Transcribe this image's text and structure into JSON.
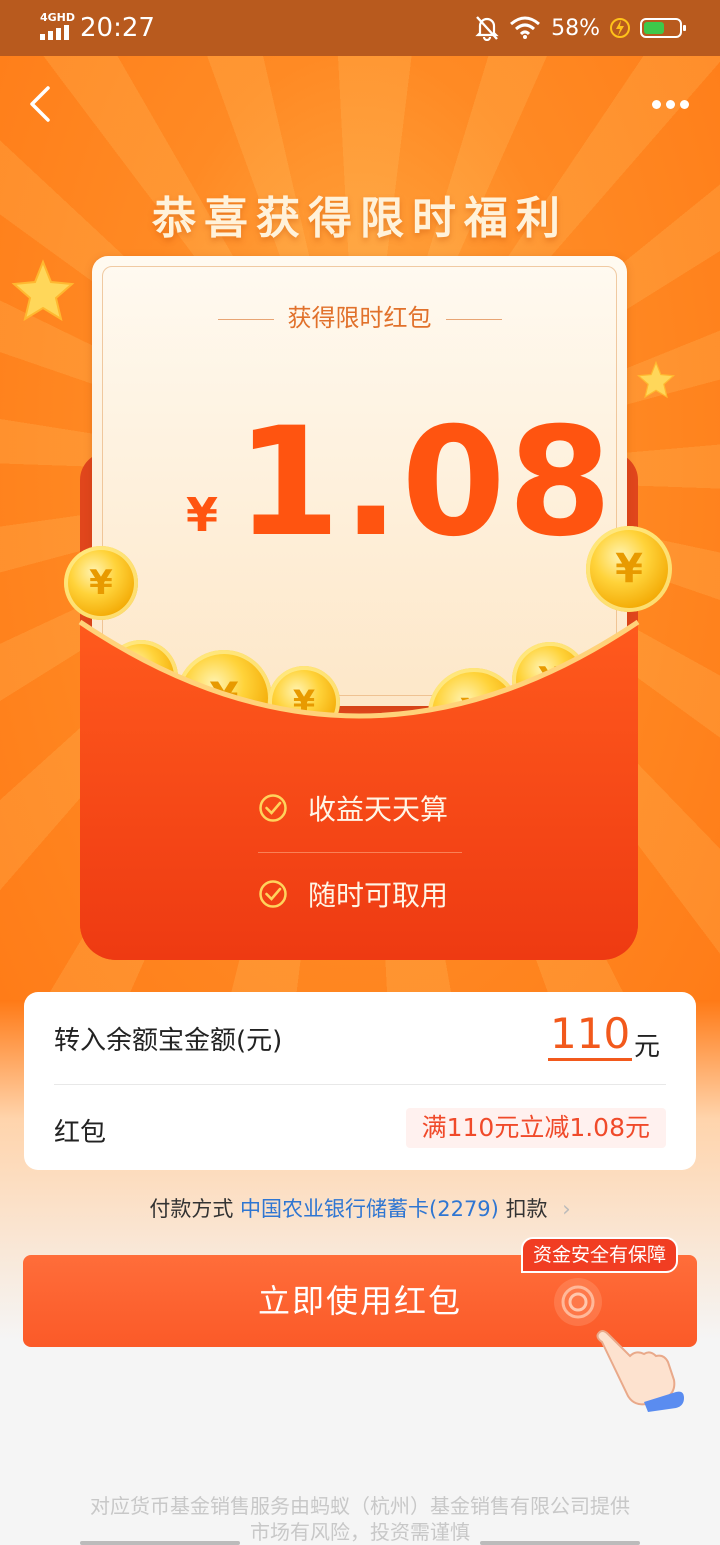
{
  "status_bar": {
    "network": "4GHD",
    "time": "20:27",
    "battery_percent": "58%",
    "battery_level": 0.58,
    "icons": [
      "signal-icon",
      "mute-bell-icon",
      "wifi-icon",
      "charging-icon",
      "battery-icon"
    ]
  },
  "nav": {
    "back_icon": "chevron-left-icon",
    "more_icon": "more-dots-icon"
  },
  "hero": {
    "title": "恭喜获得限时福利"
  },
  "red_packet": {
    "subtitle": "获得限时红包",
    "currency": "¥",
    "amount": "1.08",
    "coin_symbol": "¥",
    "features": [
      "收益天天算",
      "随时可取用"
    ]
  },
  "form": {
    "transfer_label": "转入余额宝金额(元)",
    "transfer_value": "110",
    "transfer_unit": "元",
    "packet_label": "红包",
    "packet_tag": "满110元立减1.08元"
  },
  "payment": {
    "prefix": "付款方式",
    "bank": "中国农业银行储蓄卡(2279)",
    "suffix": "扣款",
    "arrow": "›"
  },
  "cta": {
    "label": "立即使用红包",
    "badge": "资金安全有保障"
  },
  "footer": {
    "line1": "对应货币基金销售服务由蚂蚁（杭州）基金销售有限公司提供",
    "line2": "市场有风险，投资需谨慎"
  },
  "colors": {
    "accent": "#ff5410",
    "button": "#fb5a28",
    "link": "#2f76d2",
    "tag_text": "#f04a2a"
  }
}
